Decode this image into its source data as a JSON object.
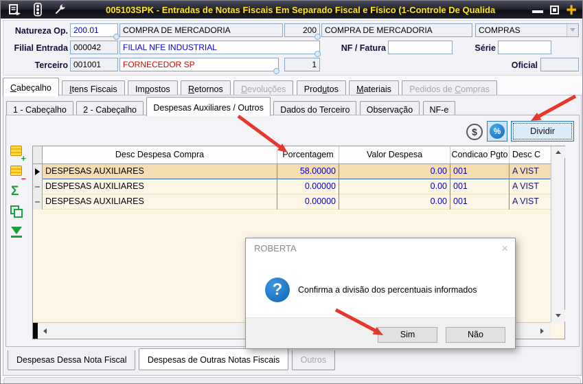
{
  "window": {
    "title": "005103SPK - Entradas de Notas Fiscais Em Separado Fiscal e Físico (1-Controle De Qualida",
    "close_glyph": "+"
  },
  "header_form": {
    "natureza_label": "Natureza Op.",
    "natureza_code": "200.01",
    "natureza_desc": "COMPRA DE MERCADORIA",
    "natureza_code2": "200",
    "natureza_desc2": "COMPRA DE MERCADORIA",
    "natureza_tipo": "COMPRAS",
    "filial_label": "Filial Entrada",
    "filial_code": "000042",
    "filial_desc": "FILIAL NFE INDUSTRIAL",
    "nf_label": "NF / Fatura",
    "nf_value": "",
    "serie_label": "Série",
    "serie_value": "",
    "terceiro_label": "Terceiro",
    "terceiro_code": "001001",
    "terceiro_desc": "FORNECEDOR SP",
    "terceiro_qty": "1",
    "oficial_label": "Oficial",
    "oficial_value": ""
  },
  "tabs_main": [
    {
      "label": "Cabeçalho",
      "accel": "C"
    },
    {
      "label": "Itens Fiscais",
      "accel": "I"
    },
    {
      "label": "Impostos",
      "accel": "p"
    },
    {
      "label": "Retornos",
      "accel": "R"
    },
    {
      "label": "Devoluções",
      "accel": "D"
    },
    {
      "label": "Produtos",
      "accel": "u"
    },
    {
      "label": "Materiais",
      "accel": "M"
    },
    {
      "label": "Pedidos de Compras",
      "accel": "C"
    }
  ],
  "tabs_sub": [
    {
      "label": "1 - Cabeçalho"
    },
    {
      "label": "2 - Cabeçalho"
    },
    {
      "label": "Despesas Auxiliares / Outros"
    },
    {
      "label": "Dados do Terceiro"
    },
    {
      "label": "Observação"
    },
    {
      "label": "NF-e"
    }
  ],
  "toolbar": {
    "currency_symbol": "$",
    "percent_symbol": "%",
    "dividir_label": "Dividir"
  },
  "grid": {
    "columns": [
      "Desc Despesa Compra",
      "Porcentagem",
      "Valor Despesa",
      "Condicao Pgto",
      "Desc C"
    ],
    "rows": [
      {
        "desc": "DESPESAS AUXILIARES",
        "porcentagem": "58.00000",
        "valor": "0.00",
        "cond": "001",
        "desc_cond": "A VIST"
      },
      {
        "desc": "DESPESAS AUXILIARES",
        "porcentagem": "0.00000",
        "valor": "0.00",
        "cond": "001",
        "desc_cond": "A VIST"
      },
      {
        "desc": "DESPESAS AUXILIARES",
        "porcentagem": "0.00000",
        "valor": "0.00",
        "cond": "001",
        "desc_cond": "A VIST"
      }
    ]
  },
  "bottom_tabs": [
    {
      "label": "Despesas Dessa Nota Fiscal"
    },
    {
      "label": "Despesas de Outras Notas Fiscais"
    },
    {
      "label": "Outros"
    }
  ],
  "dialog": {
    "title": "ROBERTA",
    "close_glyph": "×",
    "question_glyph": "?",
    "message": "Confirma a divisão dos percentuais informados",
    "yes_label": "Sim",
    "no_label": "Não"
  },
  "colors": {
    "title_text": "#ffe81a",
    "value_blue": "#0000c8",
    "value_red": "#d80000",
    "selected_row": "#f6ddb1",
    "grid_bg": "#fdf5e6",
    "arrow_red": "#e5372b",
    "percent_blue": "#0f6bb8",
    "dividir_border": "#2e75b6"
  }
}
